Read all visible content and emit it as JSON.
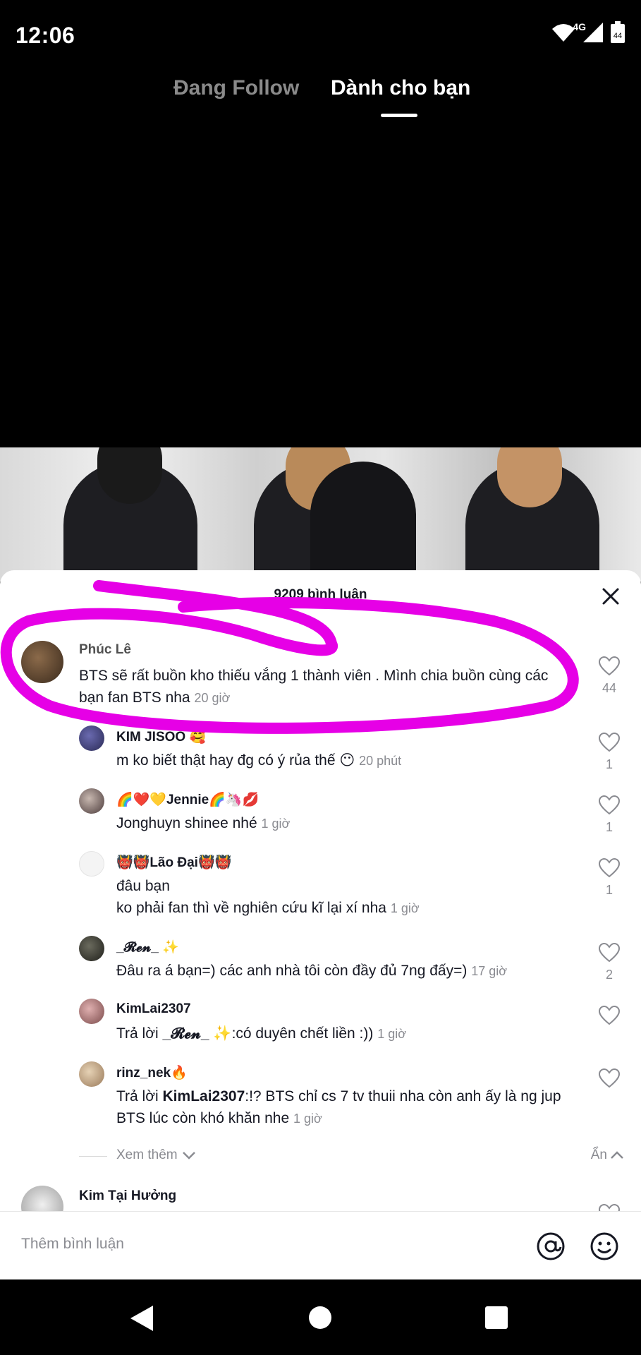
{
  "status_bar": {
    "time": "12:06",
    "network": "4G",
    "battery": "44"
  },
  "tabs": [
    {
      "label": "Đang Follow"
    },
    {
      "label": "Dành cho bạn"
    }
  ],
  "comments_sheet": {
    "title": "9209 bình luận",
    "comments": [
      {
        "user": "Phúc Lê",
        "text": "BTS sẽ rất buồn kho thiếu vắng 1 thành viên . Mình chia buồn cùng các bạn fan BTS nha",
        "time": "20 giờ",
        "likes": "44"
      },
      {
        "user": "KIM JISOO 🥰",
        "text": "m ko biết thật hay đg có ý rủa thế 😶",
        "time": "20 phút",
        "likes": "1"
      },
      {
        "user": "🌈❤️💛Jennie🌈🦄💋",
        "text": "Jonghuyn shinee nhé",
        "time": "1 giờ",
        "likes": "1"
      },
      {
        "user": "👹👹Lão Đại👹👹",
        "text_line1": "đâu bạn",
        "text": "ko phải fan thì về nghiên cứu kĩ lại xí nha",
        "time": "1 giờ",
        "likes": "1"
      },
      {
        "user": "_𝓡𝓮𝓷_ ✨",
        "text": "Đâu ra á bạn=) các anh nhà tôi còn đầy đủ 7ng đấy=)",
        "time": "17 giờ",
        "likes": "2"
      },
      {
        "user": "KimLai2307",
        "reply_prefix": "Trả lời",
        "reply_to": "_𝓡𝓮𝓷_ ✨",
        "text": ":có duyên chết liền :))",
        "time": "1 giờ",
        "likes": ""
      },
      {
        "user": "rinz_nek🔥",
        "reply_prefix": "Trả lời",
        "reply_to": "KimLai2307",
        "text": ":!? BTS chỉ cs 7 tv thuii nha còn anh ấy là ng jup BTS lúc còn khó khăn nhe",
        "time": "1 giờ",
        "likes": ""
      },
      {
        "user": "Kim Tại Hưởng"
      }
    ],
    "view_more": "Xem thêm",
    "hide": "Ẩn"
  },
  "input": {
    "placeholder": "Thêm bình luận"
  },
  "colors": {
    "annotation": "#e600e6",
    "accent_text": "#161823",
    "muted": "#8a8b91"
  },
  "icons": [
    "wifi-icon",
    "signal-icon",
    "battery-icon",
    "close-icon",
    "heart-icon",
    "chevron-down-icon",
    "chevron-up-icon",
    "at-icon",
    "emoji-icon",
    "back-icon",
    "home-icon",
    "recents-icon"
  ]
}
